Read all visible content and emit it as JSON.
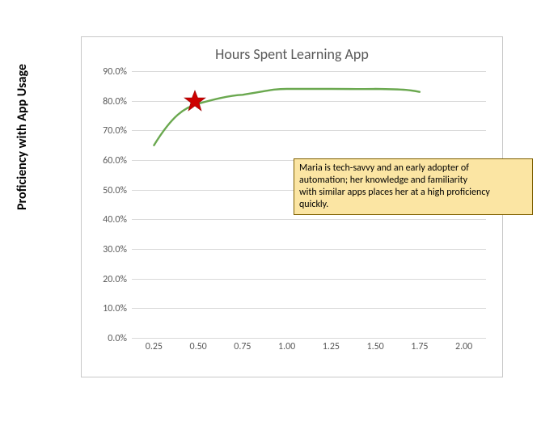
{
  "chart_data": {
    "type": "line",
    "title": "Hours Spent Learning App",
    "xlabel": "",
    "ylabel": "Proficiency with App Usage",
    "xlim": [
      0.125,
      2.125
    ],
    "ylim": [
      0,
      0.9
    ],
    "x_ticks": [
      "0.25",
      "0.50",
      "0.75",
      "1.00",
      "1.25",
      "1.50",
      "1.75",
      "2.00"
    ],
    "y_ticks": [
      "0.0%",
      "10.0%",
      "20.0%",
      "30.0%",
      "40.0%",
      "50.0%",
      "60.0%",
      "70.0%",
      "80.0%",
      "90.0%"
    ],
    "series": [
      {
        "name": "Proficiency",
        "x": [
          0.25,
          0.5,
          0.75,
          1.0,
          1.25,
          1.5,
          1.75
        ],
        "y": [
          0.65,
          0.79,
          0.82,
          0.84,
          0.84,
          0.84,
          0.83
        ],
        "color": "#6aa84f"
      }
    ],
    "marker": {
      "x": 0.48,
      "y": 0.8,
      "type": "star",
      "color": "#cc0000"
    },
    "annotation": {
      "lines": [
        "Maria is tech-savvy and an early adopter of",
        "automation; her knowledge and familiarity",
        "with similar apps places her at a high proficiency",
        "quickly."
      ]
    }
  }
}
